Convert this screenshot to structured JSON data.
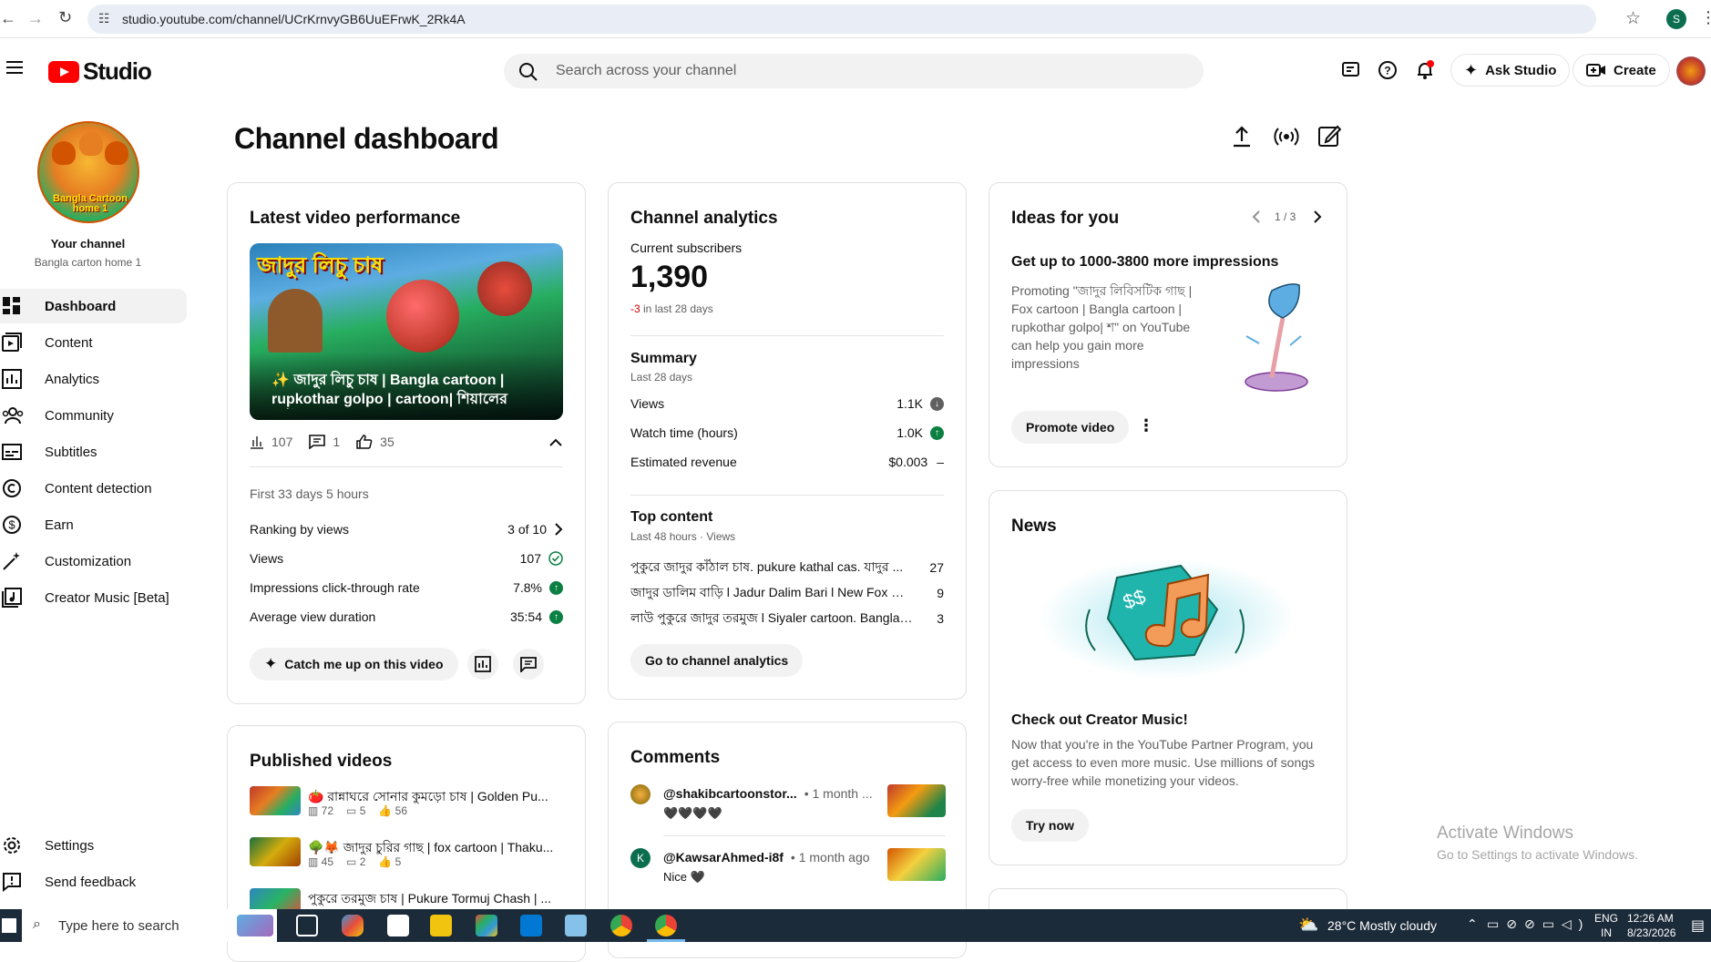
{
  "browser": {
    "url": "studio.youtube.com/channel/UCrKrnvyGB6UuEFrwK_2Rk4A",
    "profile_initial": "S"
  },
  "header": {
    "logo_text": "Studio",
    "search_placeholder": "Search across your channel",
    "ask_studio_label": "Ask Studio",
    "create_label": "Create"
  },
  "sidebar": {
    "your_channel_label": "Your channel",
    "channel_name": "Bangla carton home 1",
    "avatar_text": "Bangla Cartoon home 1",
    "items": [
      {
        "label": "Dashboard",
        "icon": "dashboard-icon"
      },
      {
        "label": "Content",
        "icon": "content-icon"
      },
      {
        "label": "Analytics",
        "icon": "analytics-icon"
      },
      {
        "label": "Community",
        "icon": "community-icon"
      },
      {
        "label": "Subtitles",
        "icon": "subtitles-icon"
      },
      {
        "label": "Content detection",
        "icon": "copyright-icon"
      },
      {
        "label": "Earn",
        "icon": "dollar-icon"
      },
      {
        "label": "Customization",
        "icon": "magic-wand-icon"
      },
      {
        "label": "Creator Music [Beta]",
        "icon": "music-icon"
      }
    ],
    "settings_label": "Settings",
    "feedback_label": "Send feedback"
  },
  "page": {
    "title": "Channel dashboard"
  },
  "latest_video": {
    "heading": "Latest video performance",
    "thumb_title_text": "জাদুর লিচু চাষ",
    "video_title": "✨ জাদুর লিচু চাষ | Bangla cartoon | rupkothar golpo | cartoon| শিয়ালের কার্টু...",
    "stat_views": "107",
    "stat_comments": "1",
    "stat_likes": "35",
    "period": "First 33 days 5 hours",
    "rows": [
      {
        "label": "Ranking by views",
        "value": "3 of 10"
      },
      {
        "label": "Views",
        "value": "107"
      },
      {
        "label": "Impressions click-through rate",
        "value": "7.8%"
      },
      {
        "label": "Average view duration",
        "value": "35:54"
      }
    ],
    "catch_up_label": "Catch me up on this video"
  },
  "analytics": {
    "heading": "Channel analytics",
    "subs_label": "Current subscribers",
    "subs_value": "1,390",
    "subs_change": "-3",
    "subs_change_suffix": "in last 28 days",
    "summary_heading": "Summary",
    "summary_period": "Last 28 days",
    "summary_rows": [
      {
        "label": "Views",
        "value": "1.1K"
      },
      {
        "label": "Watch time (hours)",
        "value": "1.0K"
      },
      {
        "label": "Estimated revenue",
        "value": "$0.003"
      }
    ],
    "top_heading": "Top content",
    "top_period": "Last 48 hours · Views",
    "top_rows": [
      {
        "title": "পুকুরে জাদুর কাঁঠাল চাষ. pukure kathal cas. যাদুর ...",
        "value": "27"
      },
      {
        "title": "জাদুর ডালিম বাড়ি l Jadur Dalim Bari l New Fox Car...",
        "value": "9"
      },
      {
        "title": "লাউ পুকুরে জাদুর তরমুজ l Siyaler cartoon. Bangla ...",
        "value": "3"
      }
    ],
    "go_button": "Go to channel analytics"
  },
  "ideas": {
    "heading": "Ideas for you",
    "pager": "1 / 3",
    "title": "Get up to 1000-3800 more impressions",
    "body": "Promoting \"জাদুর লিবিসটিক গাছ | Fox cartoon | Bangla cartoon | rupkothar golpo| শ\" on YouTube can help you gain more impressions",
    "promote_label": "Promote video"
  },
  "news": {
    "heading": "News",
    "title": "Check out Creator Music!",
    "body": "Now that you're in the YouTube Partner Program, you get access to even more music. Use millions of songs worry-free while monetizing your videos.",
    "button": "Try now"
  },
  "published": {
    "heading": "Published videos",
    "items": [
      {
        "title": "🍅 রান্নাঘরে সোনার কুমড়ো চাষ | Golden Pu...",
        "views": "72",
        "comments": "5",
        "likes": "56"
      },
      {
        "title": "🌳🦊 জাদুর চুরির গাছ | fox cartoon | Thaku...",
        "views": "45",
        "comments": "2",
        "likes": "5"
      },
      {
        "title": "পুকুরে তরমুজ চাষ | Pukure Tormuj Chash | ...",
        "views": "",
        "comments": "",
        "likes": ""
      }
    ]
  },
  "comments": {
    "heading": "Comments",
    "items": [
      {
        "author": "@shakibcartoonstor...",
        "time": "• 1 month ...",
        "text": "🖤🖤🖤🖤",
        "avatar_letter": ""
      },
      {
        "author": "@KawsarAhmed-i8f",
        "time": "• 1 month ago",
        "text": "Nice 🖤",
        "avatar_letter": "K"
      }
    ]
  },
  "watermark": {
    "line1": "Activate Windows",
    "line2": "Go to Settings to activate Windows."
  },
  "taskbar": {
    "search_placeholder": "Type here to search",
    "weather": "28°C  Mostly cloudy",
    "lang1": "ENG",
    "lang2": "IN",
    "time": "12:26 AM",
    "date": "8/23/2026"
  },
  "colors": {
    "youtube_red": "#ff0000",
    "positive_green": "#0b8043",
    "negative_red": "#cc0000",
    "taskbar_bg": "#1c2b3a"
  }
}
